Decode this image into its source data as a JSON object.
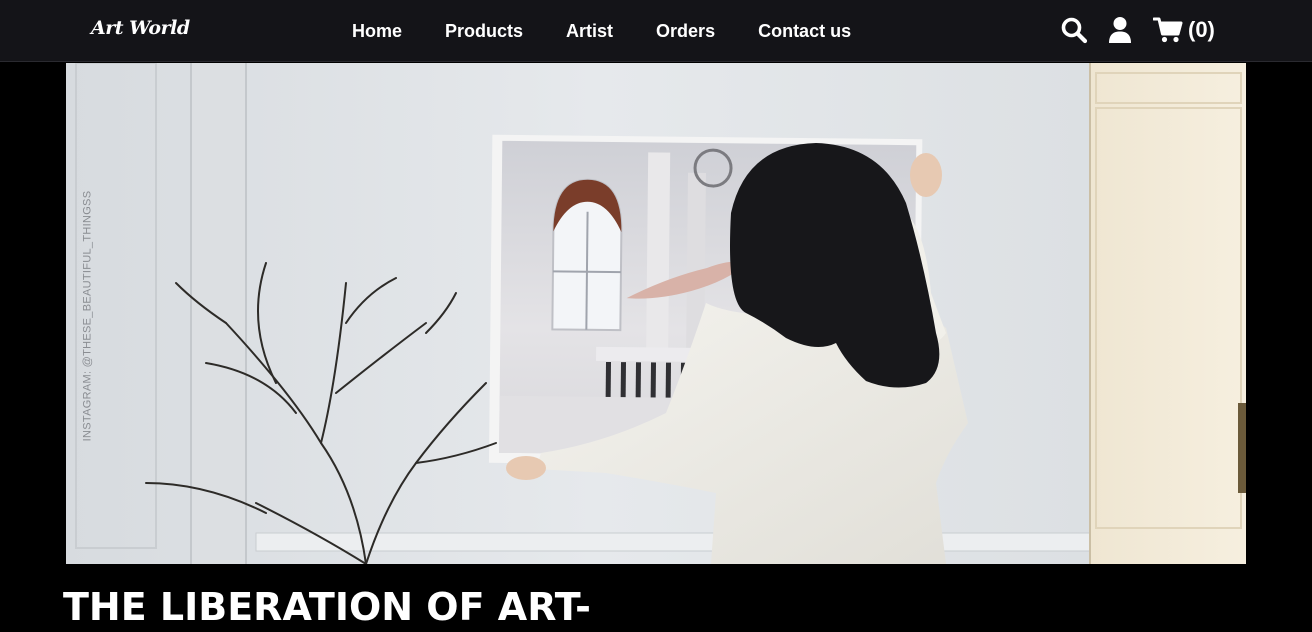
{
  "brand": {
    "name": "Art World"
  },
  "nav": {
    "items": [
      {
        "label": "Home"
      },
      {
        "label": "Products"
      },
      {
        "label": "Artist"
      },
      {
        "label": "Orders"
      },
      {
        "label": "Contact us"
      }
    ]
  },
  "toolbar": {
    "search_icon": "search-icon",
    "user_icon": "user-icon",
    "cart_icon": "cart-icon",
    "cart_count": "(0)"
  },
  "hero": {
    "watermark": "INSTAGRAM: @THESE_BEAUTIFUL_THINGSS"
  },
  "headline": {
    "text": "THE LIBERATION OF ART-"
  },
  "colors": {
    "navbar_bg": "#141418",
    "page_bg": "#000000",
    "text": "#ffffff"
  }
}
